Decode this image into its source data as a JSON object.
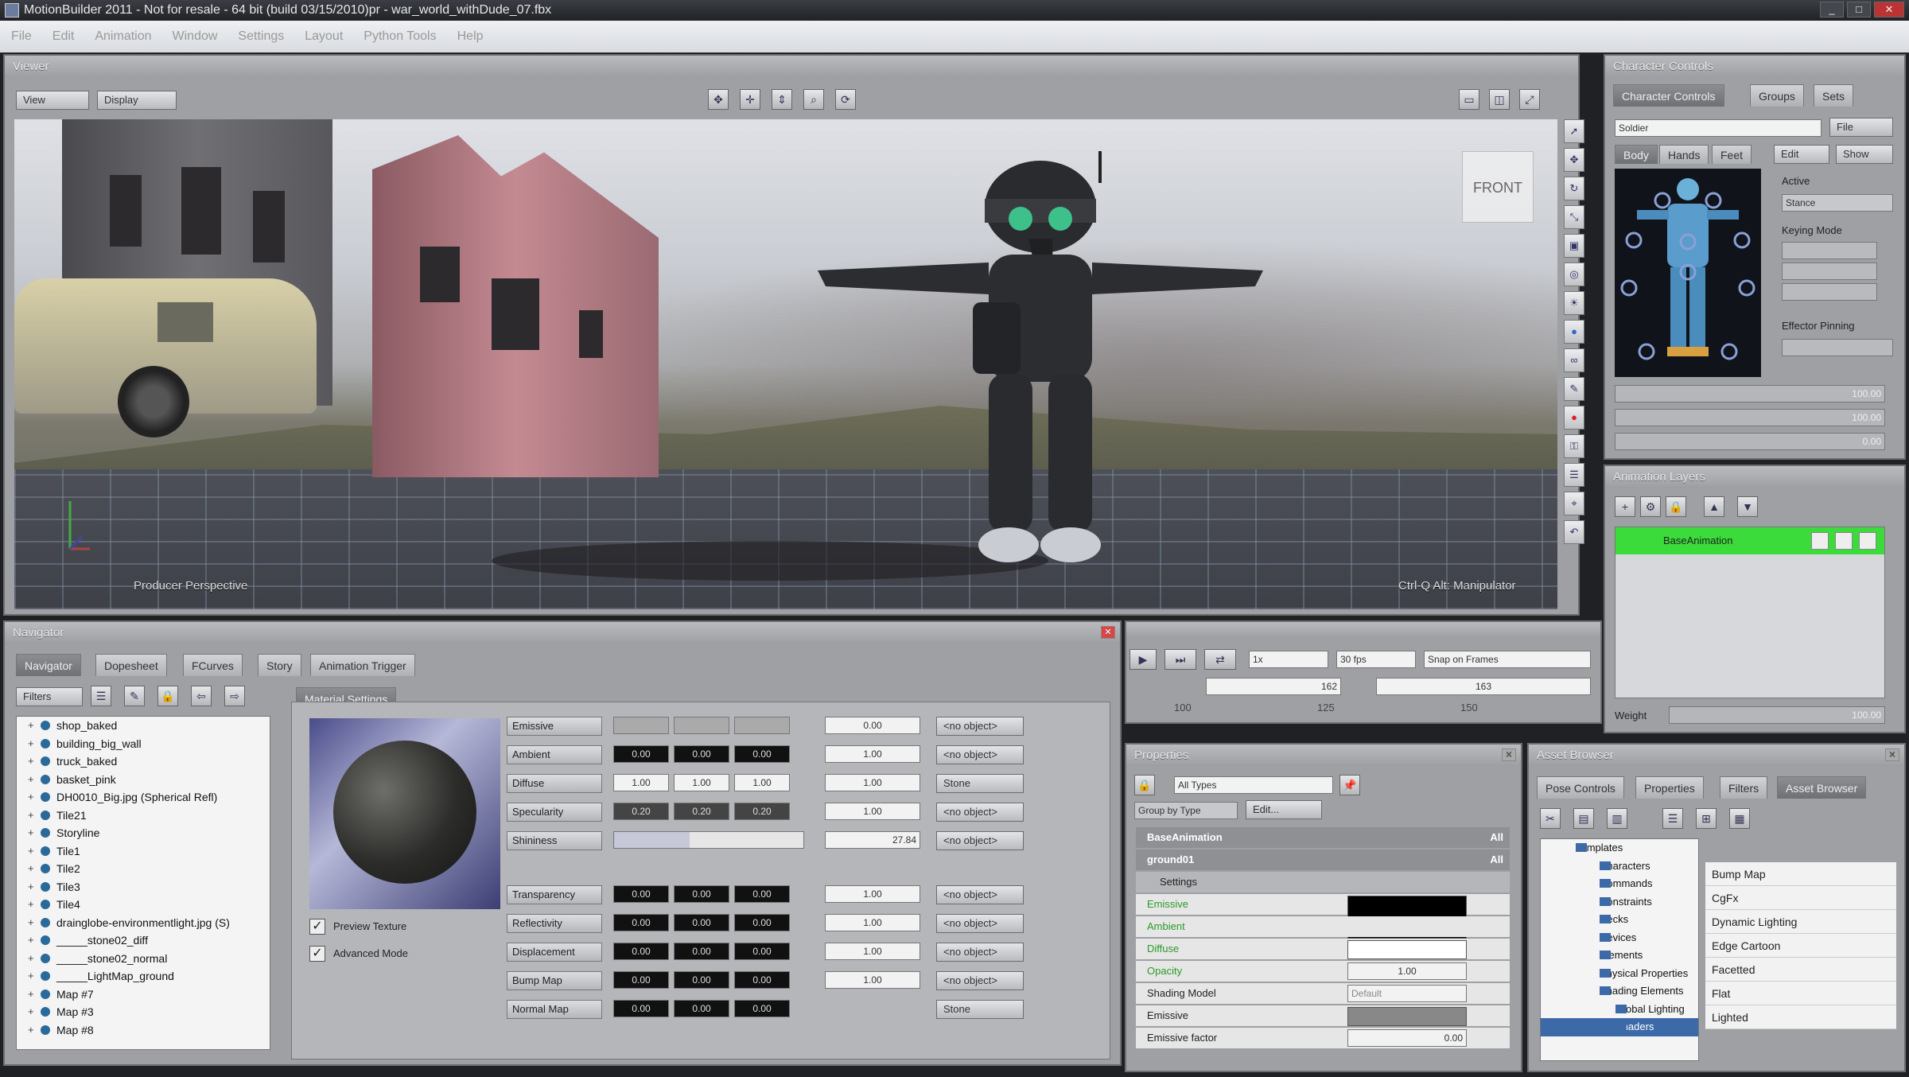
{
  "titlebar": {
    "title": "MotionBuilder 2011 - Not for resale - 64 bit (build 03/15/2010)pr - war_world_withDude_07.fbx",
    "minimize": "_",
    "maximize": "□",
    "close": "✕"
  },
  "menu": [
    "File",
    "Edit",
    "Animation",
    "Window",
    "Settings",
    "Layout",
    "Python Tools",
    "Help"
  ],
  "viewer": {
    "title": "Viewer",
    "view_btn": "View",
    "display_btn": "Display",
    "cube_label": "FRONT",
    "overlay_left": "Producer Perspective",
    "overlay_right": "Ctrl-Q Alt: Manipulator"
  },
  "character_controls": {
    "title": "Character Controls",
    "tabs": [
      "Character Controls",
      "Groups",
      "Sets"
    ],
    "character_select": "Soldier",
    "file_btn": "File",
    "body_tabs": [
      "Body",
      "Hands",
      "Feet"
    ],
    "edit_btn": "Edit",
    "show_btn": "Show",
    "active_label": "Active",
    "stance_label": "Stance",
    "keying_mode_label": "Keying Mode",
    "effector_pinning_label": "Effector Pinning",
    "slider_values": [
      "100.00",
      "100.00",
      "0.00"
    ]
  },
  "animation_layers": {
    "title": "Animation Layers",
    "layer_name": "BaseAnimation",
    "weight_label": "Weight",
    "weight_value": "100.00"
  },
  "navigator": {
    "title": "Navigator",
    "tabs": [
      "Navigator",
      "Dopesheet",
      "FCurves",
      "Story",
      "Animation Trigger"
    ],
    "filters_btn": "Filters",
    "tree": [
      "shop_baked",
      "building_big_wall",
      "truck_baked",
      "basket_pink",
      "DH0010_Big.jpg (Spherical Refl)",
      "Tile21",
      "Storyline",
      "Tile1",
      "Tile2",
      "Tile3",
      "Tile4",
      "drainglobe-environmentlight.jpg (S)",
      "_____stone02_diff",
      "_____stone02_normal",
      "_____LightMap_ground",
      "Map #7",
      "Map #3",
      "Map #8"
    ],
    "material_tab": "Material Settings",
    "preview_texture": "Preview Texture",
    "advanced_mode": "Advanced Mode",
    "rows": [
      {
        "name": "Emissive",
        "v1": "",
        "v2": "",
        "v3": "",
        "val": "0.00",
        "obj": "<no object>"
      },
      {
        "name": "Ambient",
        "v1": "0.00",
        "v2": "0.00",
        "v3": "0.00",
        "val": "1.00",
        "obj": "<no object>"
      },
      {
        "name": "Diffuse",
        "v1": "1.00",
        "v2": "1.00",
        "v3": "1.00",
        "val": "1.00",
        "obj": "Stone"
      },
      {
        "name": "Specularity",
        "v1": "0.20",
        "v2": "0.20",
        "v3": "0.20",
        "val": "1.00",
        "obj": "<no object>"
      },
      {
        "name": "Shininess",
        "v1": "",
        "v2": "",
        "v3": "",
        "val": "27.84",
        "obj": "<no object>"
      },
      {
        "name": "Transparency",
        "v1": "0.00",
        "v2": "0.00",
        "v3": "0.00",
        "val": "1.00",
        "obj": "<no object>"
      },
      {
        "name": "Reflectivity",
        "v1": "0.00",
        "v2": "0.00",
        "v3": "0.00",
        "val": "1.00",
        "obj": "<no object>"
      },
      {
        "name": "Displacement",
        "v1": "0.00",
        "v2": "0.00",
        "v3": "0.00",
        "val": "1.00",
        "obj": "<no object>"
      },
      {
        "name": "Bump Map",
        "v1": "0.00",
        "v2": "0.00",
        "v3": "0.00",
        "val": "1.00",
        "obj": "<no object>"
      },
      {
        "name": "Normal Map",
        "v1": "0.00",
        "v2": "0.00",
        "v3": "0.00",
        "val": "",
        "obj": "Stone"
      }
    ]
  },
  "transport": {
    "speed": "1x",
    "fps": "30 fps",
    "snap": "Snap on Frames",
    "frame_a": "162",
    "frame_b": "163",
    "ticks": [
      "100",
      "125",
      "150"
    ]
  },
  "properties": {
    "title": "Properties",
    "filter_select": "All Types",
    "group_by": "Group by Type",
    "edit_btn": "Edit...",
    "section1": "BaseAnimation",
    "section2": "ground01",
    "settings_label": "Settings",
    "all_label": "All",
    "rows": [
      "Emissive",
      "Ambient",
      "Diffuse",
      "Opacity",
      "Shading Model",
      "Emissive",
      "Emissive factor"
    ],
    "opacity_value": "1.00",
    "shading_value": "Default",
    "emissive_factor_value": "0.00"
  },
  "asset_browser": {
    "title": "Asset Browser",
    "tabs": [
      "Pose Controls",
      "Properties",
      "Filters",
      "Asset Browser"
    ],
    "tree": [
      "Templates",
      "Characters",
      "Commands",
      "Constraints",
      "Decks",
      "Devices",
      "Elements",
      "Physical Properties",
      "Shading Elements",
      "Global Lighting",
      "Shaders"
    ],
    "list": [
      "Bump Map",
      "CgFx",
      "Dynamic Lighting",
      "Edge Cartoon",
      "Facetted",
      "Flat",
      "Lighted"
    ]
  }
}
